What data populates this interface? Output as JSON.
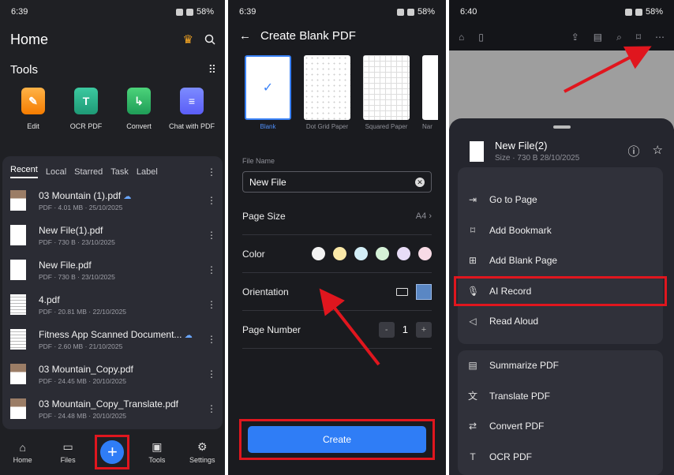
{
  "status": {
    "left": {
      "time": "6:39"
    },
    "middle": {
      "time": "6:39"
    },
    "right": {
      "time": "6:40"
    },
    "battery": "58%"
  },
  "home": {
    "title": "Home",
    "tools_title": "Tools",
    "tools": [
      {
        "label": "Edit",
        "glyph": ""
      },
      {
        "label": "OCR PDF",
        "glyph": "T"
      },
      {
        "label": "Convert",
        "glyph": "↳"
      },
      {
        "label": "Chat with PDF",
        "glyph": "≡"
      }
    ],
    "tabs": [
      "Recent",
      "Local",
      "Starred",
      "Task",
      "Label"
    ],
    "files": [
      {
        "name": "03 Mountain (1).pdf",
        "meta": "PDF · 4.01 MB · 25/10/2025"
      },
      {
        "name": "New File(1).pdf",
        "meta": "PDF · 730 B · 23/10/2025"
      },
      {
        "name": "New File.pdf",
        "meta": "PDF · 730 B · 23/10/2025"
      },
      {
        "name": "4.pdf",
        "meta": "PDF · 20.81 MB · 22/10/2025"
      },
      {
        "name": "Fitness App Scanned Document...",
        "meta": "PDF · 2.60 MB · 21/10/2025"
      },
      {
        "name": "03 Mountain_Copy.pdf",
        "meta": "PDF · 24.45 MB · 20/10/2025"
      },
      {
        "name": "03 Mountain_Copy_Translate.pdf",
        "meta": "PDF · 24.48 MB · 20/10/2025"
      }
    ],
    "nav": {
      "home": "Home",
      "files": "Files",
      "add": "+",
      "tools": "Tools",
      "settings": "Settings"
    }
  },
  "create": {
    "title": "Create Blank PDF",
    "templates": [
      "Blank",
      "Dot Grid Paper",
      "Squared Paper",
      "Nar"
    ],
    "file_name_label": "File Name",
    "file_name_value": "New File",
    "page_size_label": "Page Size",
    "page_size_value": "A4",
    "color_label": "Color",
    "colors": [
      "#f2f2f2",
      "#fbe9a8",
      "#d3eef7",
      "#d5f2d7",
      "#e8dcf7",
      "#f8dbe6"
    ],
    "orientation_label": "Orientation",
    "page_number_label": "Page Number",
    "page_number_value": "1",
    "minus": "-",
    "plus": "+",
    "create_button": "Create"
  },
  "viewer": {
    "file_title": "New File(2)",
    "file_meta": "Size · 730 B 28/10/2025",
    "menu_group1": [
      {
        "label": "Go to Page",
        "icon": "go-to-page-icon"
      },
      {
        "label": "Add Bookmark",
        "icon": "bookmark-icon"
      },
      {
        "label": "Add Blank Page",
        "icon": "add-page-icon"
      },
      {
        "label": "AI Record",
        "icon": "microphone-icon"
      },
      {
        "label": "Read Aloud",
        "icon": "speaker-icon"
      }
    ],
    "menu_group2": [
      {
        "label": "Summarize PDF",
        "icon": "summarize-icon"
      },
      {
        "label": "Translate PDF",
        "icon": "translate-icon"
      },
      {
        "label": "Convert PDF",
        "icon": "convert-icon"
      },
      {
        "label": "OCR PDF",
        "icon": "ocr-icon"
      }
    ]
  },
  "colors": {
    "accent": "#2f7df6",
    "highlight": "#e0161e",
    "background": "#1f2024"
  }
}
